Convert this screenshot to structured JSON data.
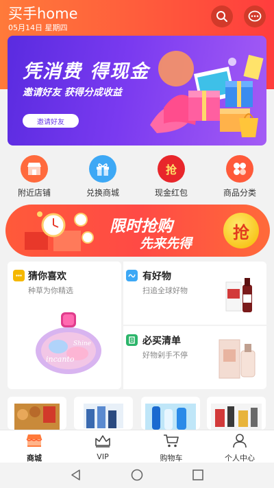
{
  "header": {
    "title": "买手home",
    "date": "05月14日 星期四"
  },
  "banner": {
    "title": "凭消费 得现金",
    "subtitle": "邀请好友  获得分成收益",
    "button_label": "邀请好友"
  },
  "categories": [
    {
      "label": "附近店铺",
      "icon": "store-icon",
      "color": "#ff6a3d"
    },
    {
      "label": "兑换商城",
      "icon": "gift-icon",
      "color": "#3da8f5"
    },
    {
      "label": "现金红包",
      "icon": "red-packet-icon",
      "color": "#e8262b",
      "icon_text": "抢"
    },
    {
      "label": "商品分类",
      "icon": "category-icon",
      "color": "#ff5a3a"
    }
  ],
  "flash_sale": {
    "title": "限时抢购",
    "subtitle": "先来先得",
    "badge": "抢"
  },
  "products": {
    "guess": {
      "title": "猜你喜欢",
      "subtitle": "种草为你精选",
      "icon_color": "#f5b800"
    },
    "goods": {
      "title": "有好物",
      "subtitle": "扫追全球好物",
      "icon_color": "#3da8f5"
    },
    "must_buy": {
      "title": "必买清单",
      "subtitle": "好物剁手不停",
      "icon_color": "#2cb56a"
    }
  },
  "tabbar": [
    {
      "label": "商城",
      "icon": "shop-icon",
      "active": true
    },
    {
      "label": "VIP",
      "icon": "crown-icon",
      "active": false
    },
    {
      "label": "购物车",
      "icon": "cart-icon",
      "active": false
    },
    {
      "label": "个人中心",
      "icon": "user-icon",
      "active": false
    }
  ],
  "colors": {
    "header_start": "#ff7a3a",
    "header_end": "#ff3d3d",
    "banner_start": "#5a2be0",
    "banner_end": "#a45cf5"
  }
}
